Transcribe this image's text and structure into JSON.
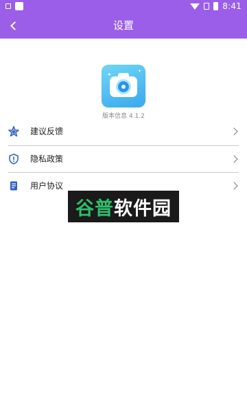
{
  "status_bar": {
    "time": "8:41",
    "icons": [
      "sim-icon",
      "notification-icon",
      "wifi-icon",
      "cellular-icon",
      "battery-icon"
    ]
  },
  "app_bar": {
    "title": "设置",
    "back_icon": "chevron-left-icon"
  },
  "app_logo": {
    "icon": "camera-icon"
  },
  "version_text": "版本信息 4.1.2",
  "menu": [
    {
      "label": "建议反馈",
      "icon": "feedback-star-icon"
    },
    {
      "label": "隐私政策",
      "icon": "shield-icon"
    },
    {
      "label": "用户协议",
      "icon": "document-icon"
    }
  ],
  "watermark": {
    "part1": "谷普",
    "part2": "软件园"
  },
  "colors": {
    "header": "#9b5ee8",
    "logo_gradient_start": "#6fd6f7",
    "logo_gradient_end": "#3aa8ef",
    "menu_icon": "#2f5fc4",
    "watermark_green": "#2fbf6b"
  }
}
